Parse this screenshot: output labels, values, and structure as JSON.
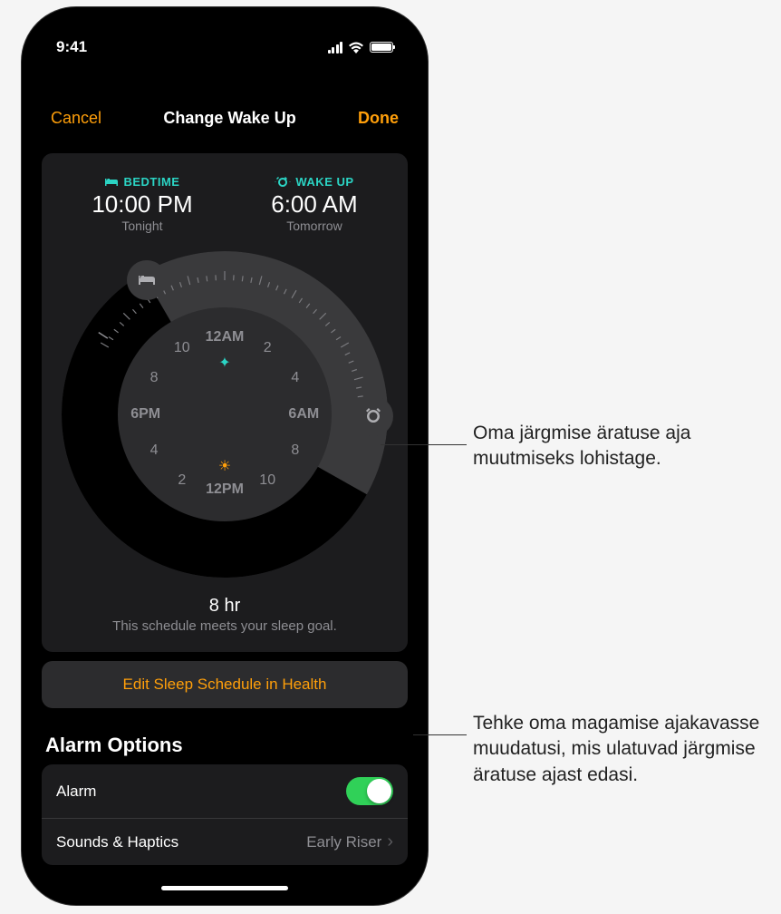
{
  "status": {
    "time": "9:41"
  },
  "nav": {
    "cancel": "Cancel",
    "title": "Change Wake Up",
    "done": "Done"
  },
  "schedule": {
    "bedtime_label": "BEDTIME",
    "bedtime_value": "10:00 PM",
    "bedtime_sub": "Tonight",
    "wakeup_label": "WAKE UP",
    "wakeup_value": "6:00 AM",
    "wakeup_sub": "Tomorrow"
  },
  "clock": {
    "top": "12AM",
    "right": "6AM",
    "bottom": "12PM",
    "left": "6PM",
    "n2": "2",
    "n4": "4",
    "n8": "8",
    "n10": "10",
    "n2b": "2",
    "n4b": "4",
    "n8b": "8",
    "n10b": "10"
  },
  "duration": {
    "value": "8 hr",
    "message": "This schedule meets your sleep goal."
  },
  "edit_button": "Edit Sleep Schedule in Health",
  "alarm_options": {
    "header": "Alarm Options",
    "alarm_label": "Alarm",
    "sounds_label": "Sounds & Haptics",
    "sounds_value": "Early Riser"
  },
  "callouts": {
    "c1": "Oma järgmise äratuse aja muutmiseks lohistage.",
    "c2": "Tehke oma magamise ajakavasse muudatusi, mis ulatuvad järgmise äratuse ajast edasi."
  }
}
